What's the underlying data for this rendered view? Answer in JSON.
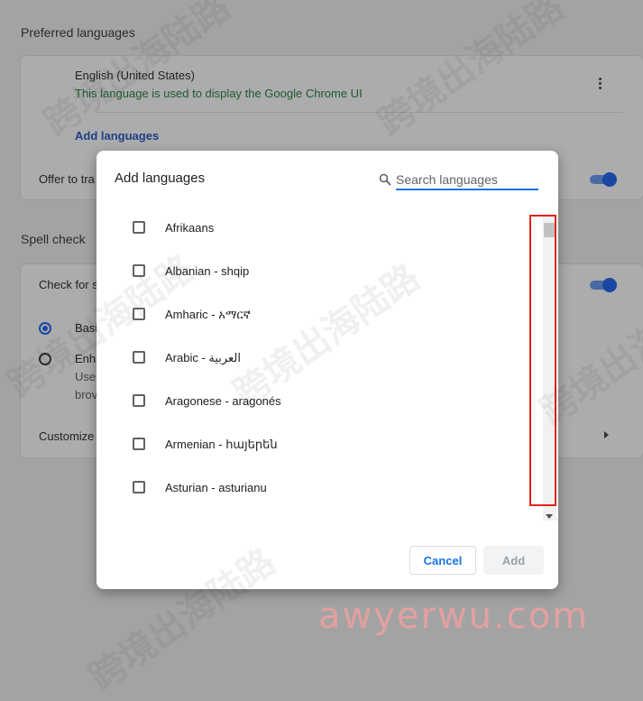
{
  "background": {
    "preferred_title": "Preferred languages",
    "language": {
      "name": "English (United States)",
      "description": "This language is used to display the Google Chrome UI"
    },
    "add_languages_link": "Add languages",
    "offer_translate_label": "Offer to tra",
    "spell_check_title": "Spell check",
    "check_for_label": "Check for s",
    "basic_label": "Basi",
    "enhanced_label": "Enha",
    "enhanced_sub1": "Use",
    "enhanced_sub2": "brov",
    "customize_label": "Customize"
  },
  "dialog": {
    "title": "Add languages",
    "search_placeholder": "Search languages",
    "languages": [
      "Afrikaans",
      "Albanian - shqip",
      "Amharic - አማርኛ",
      "Arabic - العربية",
      "Aragonese - aragonés",
      "Armenian - հայերեն",
      "Asturian - asturianu"
    ],
    "cancel_label": "Cancel",
    "add_label": "Add"
  },
  "watermark": {
    "text": "跨境出海陆路",
    "logo": "awyerwu.com"
  },
  "colors": {
    "accent": "#1a73e8",
    "toggle_on": "#1a47a2",
    "highlight": "#e2231a"
  }
}
